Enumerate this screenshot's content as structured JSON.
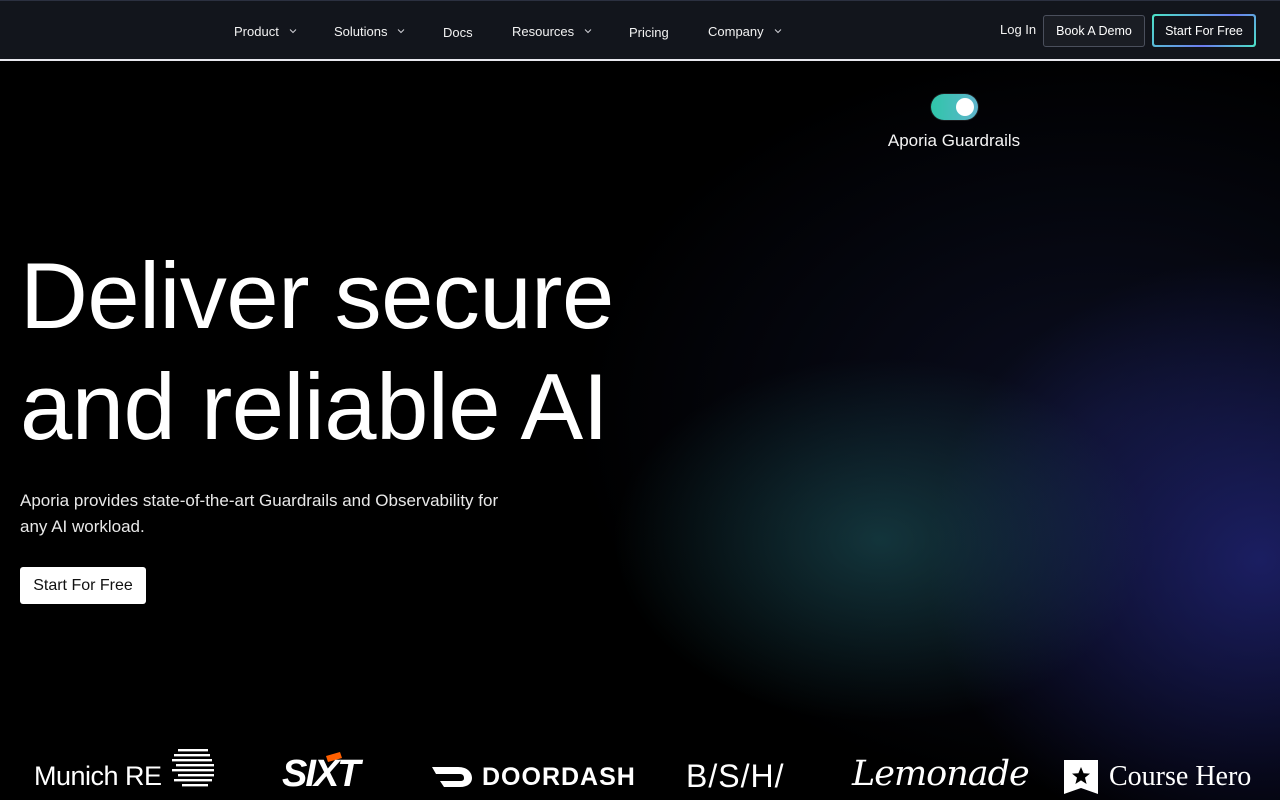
{
  "nav": {
    "items": [
      {
        "label": "Product",
        "has_dropdown": true
      },
      {
        "label": "Solutions",
        "has_dropdown": true
      },
      {
        "label": "Docs",
        "has_dropdown": false
      },
      {
        "label": "Resources",
        "has_dropdown": true
      },
      {
        "label": "Pricing",
        "has_dropdown": false
      },
      {
        "label": "Company",
        "has_dropdown": true
      }
    ],
    "login_label": "Log In",
    "demo_label": "Book A Demo",
    "start_label": "Start For Free"
  },
  "toggle": {
    "state": "on",
    "label": "Aporia Guardrails"
  },
  "hero": {
    "title_line1": "Deliver secure",
    "title_line2": "and reliable AI",
    "subtitle": "Aporia provides state-of-the-art Guardrails and Observability for any AI workload.",
    "cta_label": "Start For Free"
  },
  "logos": [
    {
      "name": "Munich RE",
      "text": "Munich RE"
    },
    {
      "name": "SIXT",
      "text": "SIXT"
    },
    {
      "name": "DoorDash",
      "text": "DOORDASH"
    },
    {
      "name": "BSH",
      "text": "B/S/H/"
    },
    {
      "name": "Lemonade",
      "text": "Lemonade"
    },
    {
      "name": "Course Hero",
      "text": "Course Hero"
    }
  ],
  "colors": {
    "nav_bg": "#12151c",
    "toggle_accent": "#2fc6a9",
    "sixt_accent": "#ff5f00",
    "glow_teal": "#1e5a5f",
    "glow_blue": "#262a8c"
  }
}
